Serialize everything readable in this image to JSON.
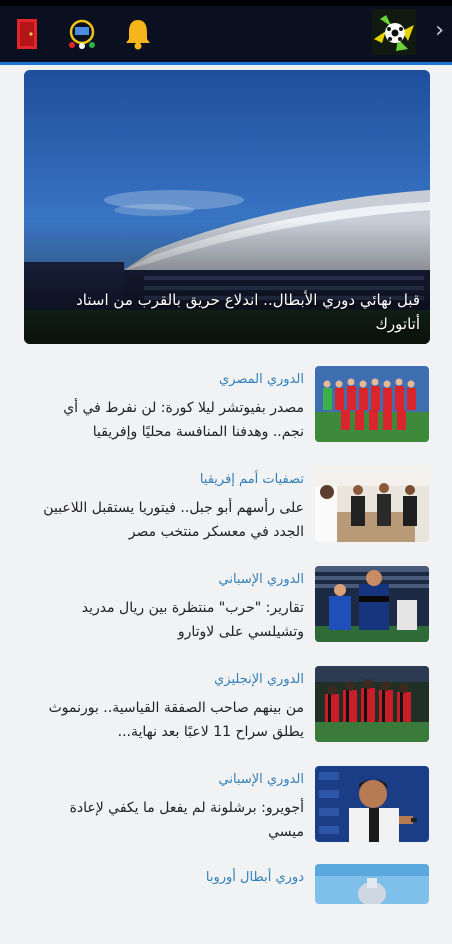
{
  "header": {
    "icons": [
      "exit-door-icon",
      "league-schedule-icon",
      "bell-icon",
      "football-logo-icon",
      "chevron-right-icon"
    ],
    "colors": {
      "background": "#0a1020",
      "accent_line": "#1f74d3",
      "bell": "#f6b51a",
      "door": "#e0262a"
    }
  },
  "featured": {
    "headline": "قبل نهائي دوري الأبطال.. اندلاع حريق بالقرب من استاد أتاتورك"
  },
  "news": [
    {
      "category": "الدوري المصري",
      "title": "مصدر بفيوتشر ليلا كورة: لن نفرط في أي نجم.. وهدفنا المنافسة محليًا وإفريقيا",
      "thumb": "team-photo-red"
    },
    {
      "category": "تصفيات أمم إفريقيا",
      "title": "على رأسهم أبو جبل.. فيتوريا يستقبل اللاعبين الجدد في معسكر منتخب مصر",
      "thumb": "coaches-meeting"
    },
    {
      "category": "الدوري الإسباني",
      "title": "تقارير: \"حرب\" منتظرة بين ريال مدريد وتشيلسي على لاوتارو",
      "thumb": "inter-player"
    },
    {
      "category": "الدوري الإنجليزي",
      "title": "من بينهم صاحب الصفقة القياسية.. بورنموث يطلق سراح 11 لاعبًا بعد نهاية...",
      "thumb": "bournemouth-huddle"
    },
    {
      "category": "الدوري الإسباني",
      "title": "أجويرو: برشلونة لم يفعل ما يكفي لإعادة ميسي",
      "thumb": "aguero-speaking"
    },
    {
      "category": "دوري أبطال أوروبا",
      "title": "",
      "thumb": "trophy"
    }
  ]
}
